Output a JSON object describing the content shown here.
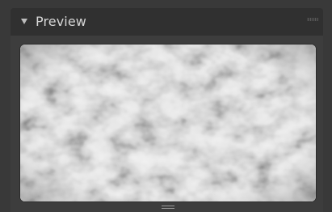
{
  "panel": {
    "title": "Preview",
    "expanded": true,
    "collapse_icon": "triangle-down-icon",
    "drag_icon": "drag-grip-icon"
  },
  "preview": {
    "content": "noise-texture",
    "resize_icon": "resize-handle-icon"
  },
  "colors": {
    "background": "#393939",
    "header": "#303030",
    "panel": "#3d3d3d",
    "title_text": "#d6d6d6"
  }
}
